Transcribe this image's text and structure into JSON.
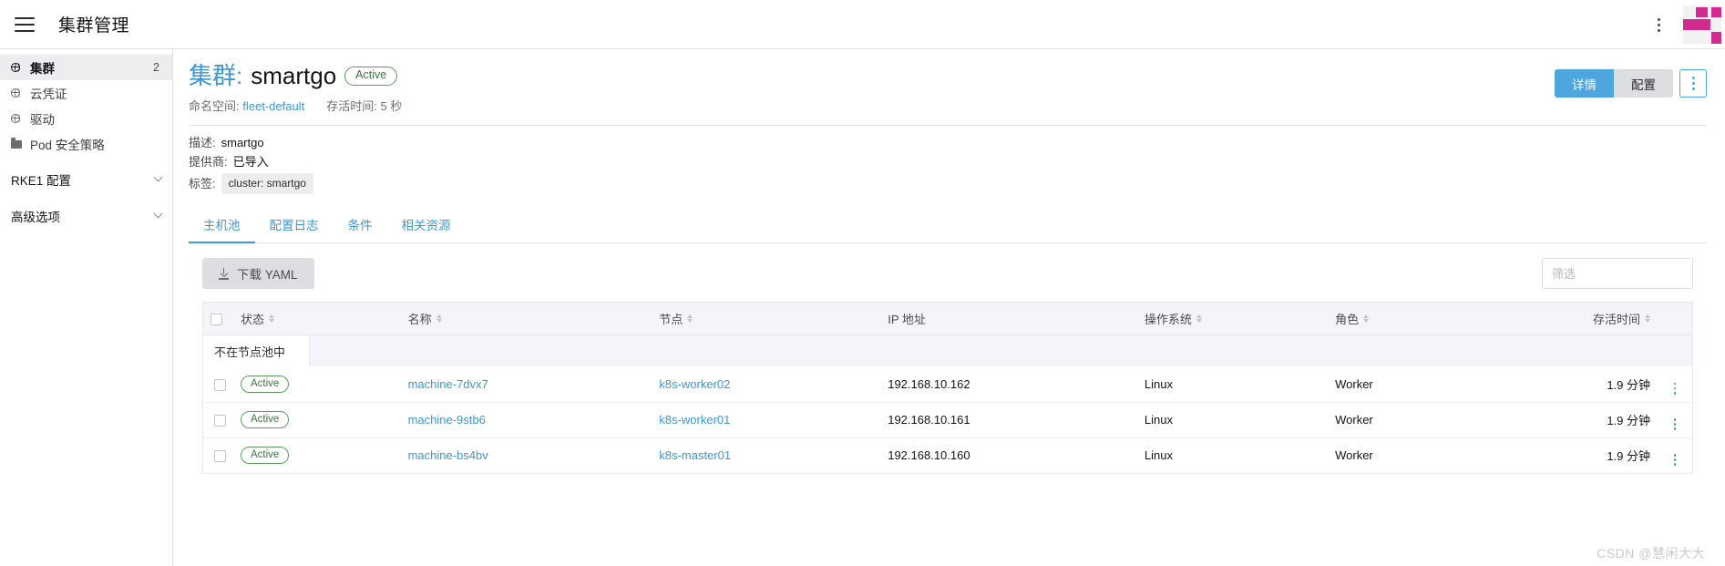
{
  "header": {
    "title": "集群管理",
    "menu_icon": "hamburger-icon",
    "kebab_icon": "vertical-dots-icon",
    "logo_color": "#d22b8f"
  },
  "sidebar": {
    "items": [
      {
        "label": "集群",
        "icon": "globe-icon",
        "count": "2",
        "active": true
      },
      {
        "label": "云凭证",
        "icon": "globe-icon",
        "count": "",
        "active": false
      },
      {
        "label": "驱动",
        "icon": "globe-icon",
        "count": "",
        "active": false
      },
      {
        "label": "Pod 安全策略",
        "icon": "folder-icon",
        "count": "",
        "active": false
      }
    ],
    "groups": [
      {
        "label": "RKE1 配置"
      },
      {
        "label": "高级选项"
      }
    ]
  },
  "page": {
    "title_prefix": "集群:",
    "title_name": "smartgo",
    "status_badge": "Active",
    "namespace_label": "命名空间:",
    "namespace_value": "fleet-default",
    "age_label": "存活时间:",
    "age_value": "5 秒",
    "meta": [
      {
        "key": "描述:",
        "value": "smartgo",
        "chip": false
      },
      {
        "key": "提供商:",
        "value": "已导入",
        "chip": false
      },
      {
        "key": "标签:",
        "value": "cluster: smartgo",
        "chip": true
      }
    ],
    "actions": {
      "primary": "详情",
      "secondary": "配置",
      "kebab": "vertical-dots-icon"
    }
  },
  "tabs": [
    {
      "label": "主机池",
      "active": true
    },
    {
      "label": "配置日志",
      "active": false
    },
    {
      "label": "条件",
      "active": false
    },
    {
      "label": "相关资源",
      "active": false
    }
  ],
  "toolbar": {
    "download_yaml": "下载 YAML",
    "download_icon": "download-icon",
    "filter_placeholder": "筛选",
    "filter_value": ""
  },
  "table": {
    "columns": [
      {
        "label": "状态",
        "sortable": true,
        "align": "left"
      },
      {
        "label": "名称",
        "sortable": true,
        "align": "left"
      },
      {
        "label": "节点",
        "sortable": true,
        "align": "left"
      },
      {
        "label": "IP 地址",
        "sortable": false,
        "align": "left"
      },
      {
        "label": "操作系统",
        "sortable": true,
        "align": "left"
      },
      {
        "label": "角色",
        "sortable": true,
        "align": "left"
      },
      {
        "label": "存活时间",
        "sortable": true,
        "align": "right"
      }
    ],
    "group_label": "不在节点池中",
    "rows": [
      {
        "status": "Active",
        "name": "machine-7dvx7",
        "node": "k8s-worker02",
        "ip": "192.168.10.162",
        "os": "Linux",
        "role": "Worker",
        "age": "1.9 分钟"
      },
      {
        "status": "Active",
        "name": "machine-9stb6",
        "node": "k8s-worker01",
        "ip": "192.168.10.161",
        "os": "Linux",
        "role": "Worker",
        "age": "1.9 分钟"
      },
      {
        "status": "Active",
        "name": "machine-bs4bv",
        "node": "k8s-master01",
        "ip": "192.168.10.160",
        "os": "Linux",
        "role": "Worker",
        "age": "1.9 分钟"
      }
    ]
  },
  "watermark": "CSDN @慧闲大大"
}
